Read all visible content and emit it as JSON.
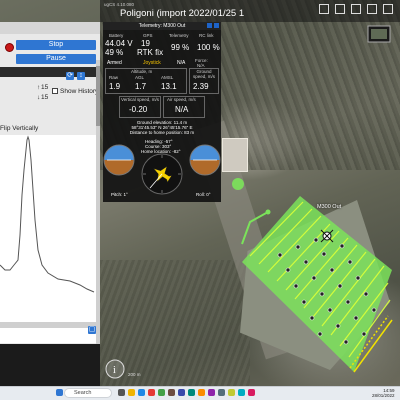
{
  "window": {
    "title": "Poligoni (import 2022/01/25 1",
    "app_name": "ugCS 4.10.080"
  },
  "left_panel": {
    "stop_label": "Stop",
    "pause_label": "Pause",
    "up_value": "15",
    "down_value": "15",
    "show_history_label": "Show History",
    "flip_label": "Flip Vertically"
  },
  "telemetry": {
    "title": "Telemetry: M300 Out",
    "battery_caption": "Battery",
    "gps_caption": "GPS",
    "telem_caption": "Telemetry",
    "rc_caption": "RC link",
    "battery_voltage": "44.04 V",
    "battery_percent": "49 %",
    "gps_sats": "19",
    "gps_fix": "RTK fix",
    "telemetry_quality": "99 %",
    "rc_quality": "100 %",
    "armed": "Armed",
    "joystick": "Joystick",
    "na": "N/A",
    "force": "Force:",
    "force_val": "N/A",
    "altitude_caption": "Altitude, m",
    "ground_speed_caption": "Ground speed, m/s",
    "raw_caption": "Raw",
    "agl_caption": "AGL",
    "amsl_caption": "AMSL",
    "raw_val": "1.9",
    "agl_val": "1.7",
    "amsl_val": "13.1",
    "ground_speed_val": "2.39",
    "vspeed_caption": "Vertical speed, m/s",
    "airspeed_caption": "Air speed, m/s",
    "vspeed_val": "-0.20",
    "airspeed_val": "N/A",
    "ground_elevation": "Ground elevation: 11.4 m",
    "coordinates": "58°31'45.53\" N 26°45'15.76\" E",
    "distance_home": "Distance to home position: 83 m",
    "heading": "Heading: -57°",
    "course": "Course: 303°",
    "home_location": "Home location: -82°",
    "pitch": "Pitch: 1°",
    "roll": "Roll: 0°"
  },
  "map": {
    "vehicle_label": "M300 Out",
    "zoom_hint": "i",
    "scale_text": "200 m"
  },
  "taskbar": {
    "search_placeholder": "Search",
    "time": "14:59",
    "date": "28/01/2022",
    "accent": "#2f76d2"
  }
}
